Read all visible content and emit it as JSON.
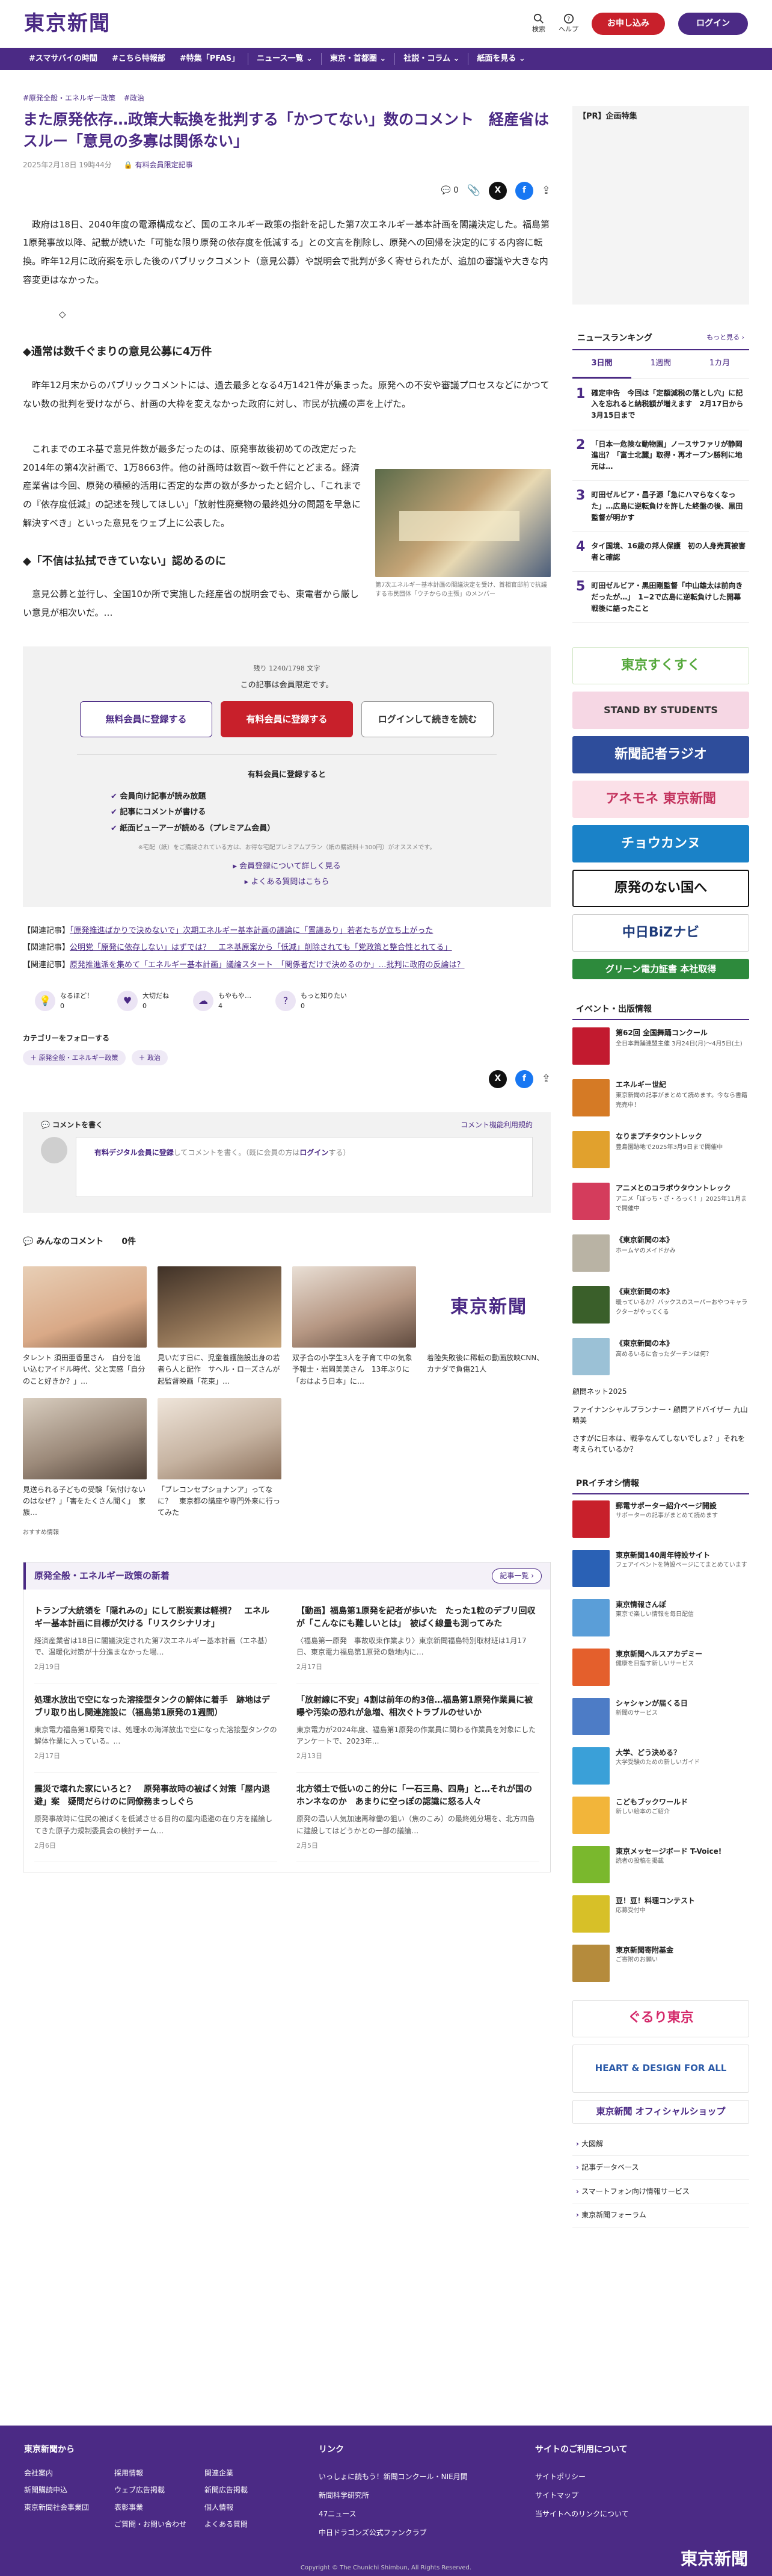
{
  "header": {
    "logo": "東京新聞",
    "icons": [
      {
        "label": "検索",
        "icon": "search-icon"
      },
      {
        "label": "ヘルプ",
        "icon": "help-icon"
      }
    ],
    "signup": "お申し込み",
    "login": "ログイン"
  },
  "nav": {
    "items": [
      "#スマサバイの時間",
      "#こちら特報部",
      "#特集「PFAS」",
      "ニュース一覧 ⌄",
      "東京・首都圏 ⌄",
      "社説・コラム ⌄",
      "紙面を見る ⌄"
    ]
  },
  "article": {
    "categories": [
      "#原発全般・エネルギー政策",
      "#政治"
    ],
    "title": "また原発依存…政策大転換を批判する「かつてない」数のコメント　経産省はスルー「意見の多寡は関係ない」",
    "date": "2025年2月18日 19時44分",
    "paywall_tag": "有料会員限定記事",
    "comment_count": "0",
    "p1": "政府は18日、2040年度の電源構成など、国のエネルギー政策の指針を記した第7次エネルギー基本計画を閣議決定した。福島第1原発事故以降、記載が続いた「可能な限り原発の依存度を低減する」との文言を削除し、原発への回帰を決定的にする内容に転換。昨年12月に政府案を示した後のパブリックコメント（意見公募）や説明会で批判が多く寄せられたが、追加の審議や大きな内容変更はなかった。",
    "h1": "◆通常は数千ぐまりの意見公募に4万件",
    "p2": "昨年12月末からのパブリックコメントには、過去最多となる4万1421件が集まった。原発への不安や審議プロセスなどにかつてない数の批判を受けながら、計画の大枠を変えなかった政府に対し、市民が抗議の声を上げた。",
    "p3": "これまでのエネ基で意見件数が最多だったのは、原発事故後初めての改定だった2014年の第4次計画で、1万8663件。他の計画時は数百〜数千件にとどまる。経済産業省は今回、原発の積極的活用に否定的な声の数が多かったと紹介し、「これまでの『依存度低減』の記述を残してほしい」「放射性廃棄物の最終処分の問題を早急に解決すべき」といった意見をウェブ上に公表した。",
    "h2": "◆「不信は払拭できていない」認めるのに",
    "p4": "意見公募と並行し、全国10か所で実施した経産省の説明会でも、東電者から厳しい意見が相次いだ。…",
    "caption": "第7次エネルギー基本計画の閣議決定を受け、首相官邸前で抗議する市民団体「ウチからの主張」のメンバー",
    "paywall": {
      "remaining": "残り 1240/1798 文字",
      "text": "この記事は会員限定です。",
      "free": "無料会員に登録する",
      "paid": "有料会員に登録する",
      "login": "ログインして続きを読む",
      "benefits_title": "有料会員に登録すると",
      "benefits": [
        "会員向け記事が読み放題",
        "記事にコメントが書ける",
        "紙面ビューアーが読める（プレミアム会員）"
      ],
      "note": "※宅配（紙）をご購読されている方は、お得な宅配プレミアムプラン（紙の購読料＋300円）がオススメです。",
      "link1": "会員登録について詳しく見る",
      "link2": "よくある質問はこちら"
    },
    "related": [
      {
        "label": "【関連記事】",
        "text": "「原発推進ばかりで決めないで」次期エネルギー基本計画の議論に「置議あり」若者たちが立ち上がった"
      },
      {
        "label": "【関連記事】",
        "text": "公明党「原発に依存しない」はずでは？　エネ基原案から「低減」削除されても「党政策と整合性とれてる」"
      },
      {
        "label": "【関連記事】",
        "text": "原発推進派を集めて「エネルギー基本計画」議論スタート　「関係者だけで決めるのか」…批判に政府の反論は？"
      }
    ],
    "reactions": [
      {
        "label": "なるほど！",
        "count": "0"
      },
      {
        "label": "大切だね",
        "count": "0"
      },
      {
        "label": "もやもや…",
        "count": "4"
      },
      {
        "label": "もっと知りたい",
        "count": "0"
      }
    ],
    "follow_label": "カテゴリーをフォローする",
    "follow_tags": [
      "＋ 原発全般・エネルギー政策",
      "＋ 政治"
    ]
  },
  "comments": {
    "title": "コメントを書く",
    "guide": "コメント機能利用規約",
    "placeholder_link": "有料デジタル会員に登録",
    "placeholder_text": "してコメントを書く。（既に会員の方は",
    "placeholder_login": "ログイン",
    "placeholder_end": "する）",
    "everyone": "みんなのコメント",
    "count": "0件"
  },
  "recommend": [
    {
      "text": "タレント 須田亜香里さん　自分を追い込むアイドル時代、父と実感「自分のこと好きか？」…",
      "color": "#d9a987"
    },
    {
      "text": "見いだす日に、児童養護施設出身の若者ら人と配作　サヘル・ローズさんが起監督映画「花束」…",
      "color": "#8a6e52"
    },
    {
      "text": "双子合の小学生3人を子育て中の気象予報士・岩岡美美さん　13年ぶりに「おはよう日本」に…",
      "color": "#b69783"
    },
    {
      "text": "着陸失敗後に稀転の動画放映CNN、カナダで負傷21人",
      "color": "#ffffff"
    },
    {
      "text": "見送られる子どもの受験「気付けないのはなぜ？」「害をたくさん聞く」　家族…",
      "color": "#9c8a7a"
    },
    {
      "text": "「ブレコンセプショナンア」ってなに？　東京都の講座や専門外来に行ってみた",
      "color": "#c6b3a1"
    }
  ],
  "recommend_label": "おすすめ情報",
  "series": {
    "title": "原発全般・エネルギー政策の新着",
    "more": "記事一覧 ›",
    "items": [
      {
        "title": "トランプ大統領を「隠れみの」にして脱炭素は軽視？　エネルギー基本計画に目標が欠ける「リスクシナリオ」",
        "text": "経済産業省は18日に閣議決定された第7次エネルギー基本計画（エネ基）で、温暖化対策が十分進まなかった場…",
        "date": "2月19日"
      },
      {
        "title": "【動画】福島第1原発を記者が歩いた　たった1粒のデブリ回収が「こんなにも難しいとは」　被ばく線量も測ってみた",
        "text": "〈福島第一原発　事故収束作業より〉東京新聞福島特別取材班は1月17日、東京電力福島第1原発の敷地内に…",
        "date": "2月17日"
      },
      {
        "title": "処理水放出で空になった溶接型タンクの解体に着手　跡地はデブリ取り出し関連施設に（福島第1原発の1週間）",
        "text": "東京電力福島第1原発では、処理水の海洋放出で空になった溶接型タンクの解体作業に入っている。…",
        "date": "2月17日"
      },
      {
        "title": "「放射線に不安」4割は前年の約3倍…福島第1原発作業員に被曝や汚染の恐れが急増、相次ぐトラブルのせいか",
        "text": "東京電力が2024年度、福島第1原発の作業員に関わる作業員を対象にしたアンケートで、2023年…",
        "date": "2月13日"
      },
      {
        "title": "震災で壊れた家にいろと？　原発事故時の被ばく対策「屋内退避」案　疑問だらけのに同僚務まっしぐら",
        "text": "原発事故時に住民の被ばくを低減させる目的の屋内退避の在り方を議論してきた原子力規制委員会の検討チーム…",
        "date": "2月6日"
      },
      {
        "title": "北方領土で低いのこ的分に「一石三鳥、四鳥」と…それが国のホンネなのか　あまりに空っぽの認識に怒る人々",
        "text": "原発の温い人気加速再稼働の狙い（焦のこみ）の最終処分場を、北方四島に建設してはどうかとの一部の議論…",
        "date": "2月5日"
      }
    ]
  },
  "sidebar": {
    "pr_title": "【PR】企画特集",
    "ranking_title": "ニュースランキング",
    "ranking_more": "もっと見る ›",
    "tabs": [
      "3日間",
      "1週間",
      "1カ月"
    ],
    "ranking": [
      "確定申告　今回は「定額減税の落とし穴」に記入を忘れると納税額が増えます　2月17日から3月15日まで",
      "「日本一危険な動物園」ノースサファリが静岡進出？「富士北麓」取得・再オープン勝利に地元は…",
      "町田ゼルビア・昌子源「急にハマらなくなった」…広島に逆転負けを許した終盤の後、黒田監督が明かす",
      "タイ国境、16歳の邦人保護　初の人身売買被害者と確認",
      "町田ゼルビア・黒田剛監督「中山雄太は前向きだったが…」　1−2で広島に逆転負けした開幕戦後に語ったこと"
    ],
    "banners": [
      {
        "text": "東京すくすく",
        "bg": "#ffffff",
        "fg": "#55a83c"
      },
      {
        "text": "STAND BY STUDENTS",
        "bg": "#f6d7e4",
        "fg": "#333"
      },
      {
        "text": "新聞記者ラジオ",
        "bg": "#2e4d9b",
        "fg": "#fff"
      },
      {
        "text": "アネモネ 東京新聞",
        "bg": "#fbe0e8",
        "fg": "#c3325d"
      },
      {
        "text": "チョウカンヌ",
        "bg": "#1a82c8",
        "fg": "#fff"
      },
      {
        "text": "原発のない国へ",
        "bg": "#ffffff",
        "fg": "#111"
      },
      {
        "text": "中日BiZナビ",
        "bg": "#ffffff",
        "fg": "#1d3a7a"
      },
      {
        "text": "グリーン電力証書 本社取得",
        "bg": "#2d8a3c",
        "fg": "#fff"
      }
    ],
    "events_title": "イベント・出版情報",
    "events": [
      {
        "title": "第62回 全国舞踊コンクール",
        "desc": "全日本舞踊連盟主催 3月24日(月)〜4月5日(土)",
        "color": "#c21a2f"
      },
      {
        "title": "エネルギー世紀",
        "desc": "東京新聞の記事がまとめて読めます。今なら書籍完売中！",
        "color": "#d57a25"
      },
      {
        "title": "なりまプチタウントレック",
        "desc": "豊島園跡地で2025年3月9日まで開催中",
        "color": "#e1a12d"
      },
      {
        "title": "アニメとのコラボウタウントレック",
        "desc": "アニメ「ぼっち・ざ・ろっく！」2025年11月まで開催中",
        "color": "#d43c5c"
      },
      {
        "title": "《東京新聞の本》",
        "desc": "ホームヤのメイドかみ",
        "color": "#b9b3a4"
      },
      {
        "title": "《東京新聞の本》",
        "desc": "暖っているか？バックスのスーパーおやつキャラクターがやってくる",
        "color": "#3a5f2a"
      },
      {
        "title": "《東京新聞の本》",
        "desc": "高めるいるに合ったダーチンは何？",
        "color": "#9bc1d6"
      }
    ],
    "misc": [
      "顧問ネット2025",
      "ファイナンシャルプランナー・顧問アドバイザー 九山晴美",
      "さすがに日本は、戦争なんてしないでしょ？」それを考えられているか？"
    ],
    "pr_title2": "PRイチオシ情報",
    "pr_items": [
      {
        "title": "郵電サポーター紹介ページ開設",
        "desc": "サポーターの記事がまとめて読めます",
        "color": "#c8202b"
      },
      {
        "title": "東京新聞140周年特設サイト",
        "desc": "フェアイベントを特設ページにてまとめています",
        "color": "#2a61b5"
      },
      {
        "title": "東京情報さんぽ",
        "desc": "東京で楽しい情報を毎日配信",
        "color": "#5a9ed8"
      },
      {
        "title": "東京新聞ヘルスアカデミー",
        "desc": "健康を目指す新しいサービス",
        "color": "#e45f2c"
      },
      {
        "title": "シャシャンが届くる日",
        "desc": "新聞のサービス",
        "color": "#4d7cc6"
      },
      {
        "title": "大学、どう決める？",
        "desc": "大学受験のための新しいガイド",
        "color": "#3aa0d8"
      },
      {
        "title": "こどもブックワールド",
        "desc": "新しい絵本のご紹介",
        "color": "#f2b53a"
      },
      {
        "title": "東京メッセージボード T-Voice!",
        "desc": "読者の投稿を掲載",
        "color": "#7ab82d"
      },
      {
        "title": "豆！豆！料理コンテスト",
        "desc": "応募受付中",
        "color": "#d7c028"
      },
      {
        "title": "東京新聞寄附基金",
        "desc": "ご寄附のお願い",
        "color": "#b58b3c"
      }
    ],
    "banners2": [
      {
        "text": "ぐるり東京",
        "bg": "#ffffff",
        "fg": "#d42a6b"
      },
      {
        "text": "HEART & DESIGN FOR ALL",
        "bg": "#ffffff",
        "fg": "#2b5aa8"
      },
      {
        "text": "東京新聞 オフィシャルショップ",
        "bg": "#ffffff",
        "fg": "#4b2a85"
      }
    ],
    "links": [
      "大図解",
      "記事データベース",
      "スマートフォン向け情報サービス",
      "東京新聞フォーラム"
    ]
  },
  "footer": {
    "col1_title": "東京新聞から",
    "col1_items": [
      "会社案内",
      "新聞購読申込",
      "東京新聞社会事業団",
      "採用情報",
      "ウェブ広告掲載",
      "表彰事業",
      "ご質問・お問い合わせ",
      "関連企業",
      "新聞広告掲載",
      "個人情報",
      "よくある質問"
    ],
    "col2_title": "リンク",
    "col2_items": [
      "いっしょに読もう！新聞コンクール・NIE月間",
      "新聞科学研究所",
      "47ニュース",
      "中日ドラゴンズ公式ファンクラブ"
    ],
    "col3_title": "サイトのご利用について",
    "col3_items": [
      "サイトポリシー",
      "サイトマップ",
      "当サイトへのリンクについて"
    ],
    "logo": "東京新聞",
    "copyright": "Copyright © The Chunichi Shimbun, All Rights Reserved."
  }
}
